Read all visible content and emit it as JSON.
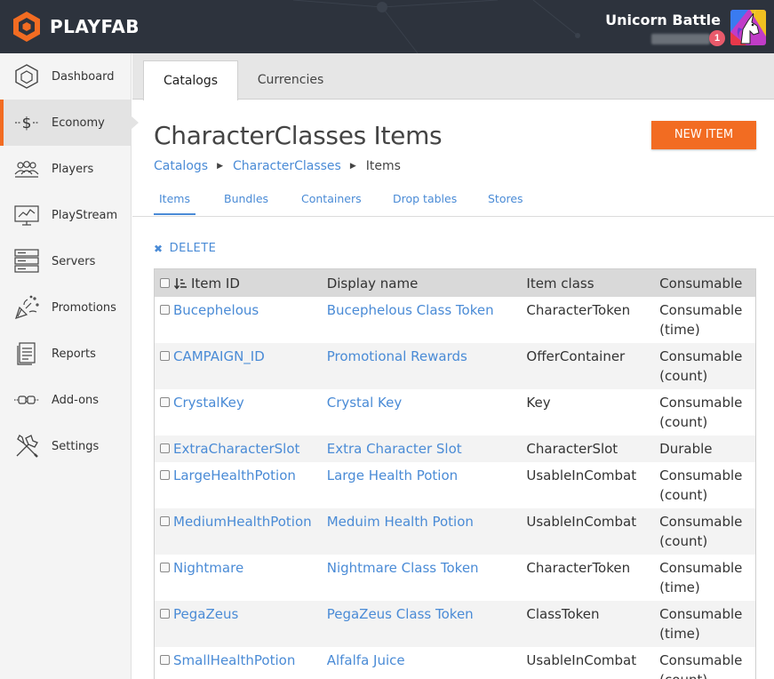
{
  "app": {
    "brand": "PLAYFAB",
    "title": "Unicorn Battle",
    "notification_count": "1"
  },
  "sidebar": {
    "items": [
      {
        "label": "Dashboard",
        "icon": "hexagon-icon",
        "active": false
      },
      {
        "label": "Economy",
        "icon": "dollar-icon",
        "active": true
      },
      {
        "label": "Players",
        "icon": "players-icon",
        "active": false
      },
      {
        "label": "PlayStream",
        "icon": "playstream-icon",
        "active": false
      },
      {
        "label": "Servers",
        "icon": "servers-icon",
        "active": false
      },
      {
        "label": "Promotions",
        "icon": "party-popper-icon",
        "active": false
      },
      {
        "label": "Reports",
        "icon": "reports-icon",
        "active": false
      },
      {
        "label": "Add-ons",
        "icon": "plug-icon",
        "active": false
      },
      {
        "label": "Settings",
        "icon": "tools-icon",
        "active": false
      }
    ]
  },
  "tabs": [
    {
      "label": "Catalogs",
      "active": true
    },
    {
      "label": "Currencies",
      "active": false
    }
  ],
  "page": {
    "title": "CharacterClasses Items",
    "new_item_label": "NEW ITEM",
    "breadcrumb": [
      "Catalogs",
      "CharacterClasses",
      "Items"
    ],
    "subtabs": [
      "Items",
      "Bundles",
      "Containers",
      "Drop tables",
      "Stores"
    ],
    "delete_label": "DELETE"
  },
  "table": {
    "headers": [
      "Item ID",
      "Display name",
      "Item class",
      "Consumable"
    ],
    "rows": [
      {
        "id": "Bucephelous",
        "display": "Bucephelous Class Token",
        "class": "CharacterToken",
        "consumable": [
          "Consumable",
          "(time)"
        ]
      },
      {
        "id": "CAMPAIGN_ID",
        "display": "Promotional Rewards",
        "class": "OfferContainer",
        "consumable": [
          "Consumable",
          "(count)"
        ]
      },
      {
        "id": "CrystalKey",
        "display": "Crystal Key",
        "class": "Key",
        "consumable": [
          "Consumable",
          "(count)"
        ]
      },
      {
        "id": "ExtraCharacterSlot",
        "display": "Extra Character Slot",
        "class": "CharacterSlot",
        "consumable": [
          "Durable"
        ]
      },
      {
        "id": "LargeHealthPotion",
        "display": "Large Health Potion",
        "class": "UsableInCombat",
        "consumable": [
          "Consumable",
          "(count)"
        ]
      },
      {
        "id": "MediumHealthPotion",
        "display": "Meduim Health Potion",
        "class": "UsableInCombat",
        "consumable": [
          "Consumable",
          "(count)"
        ]
      },
      {
        "id": "Nightmare",
        "display": "Nightmare Class Token",
        "class": "CharacterToken",
        "consumable": [
          "Consumable",
          "(time)"
        ]
      },
      {
        "id": "PegaZeus",
        "display": "PegaZeus Class Token",
        "class": "ClassToken",
        "consumable": [
          "Consumable",
          "(time)"
        ]
      },
      {
        "id": "SmallHealthPotion",
        "display": "Alfalfa Juice",
        "class": "UsableInCombat",
        "consumable": [
          "Consumable",
          "(count)"
        ]
      }
    ]
  },
  "colors": {
    "accent": "#f26c22",
    "link": "#4a8bd6",
    "topbar": "#2d333d",
    "sidebar": "#f4f4f4"
  }
}
